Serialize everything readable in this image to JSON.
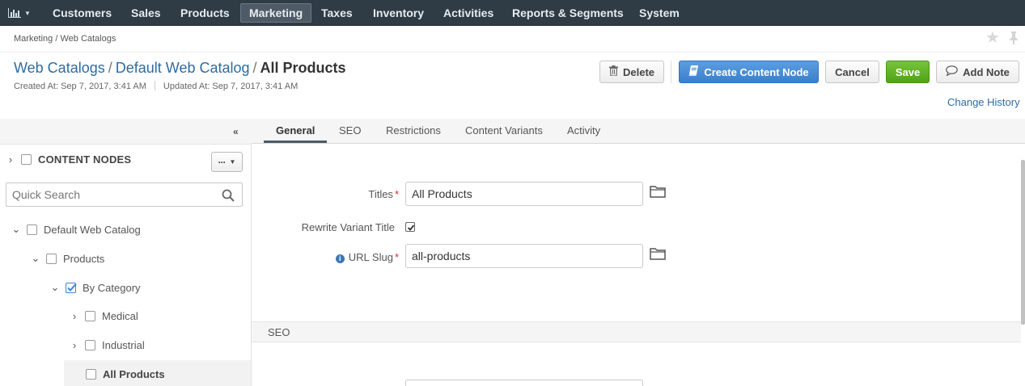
{
  "nav": {
    "logo_icon": "bar-chart-icon",
    "items": [
      "Customers",
      "Sales",
      "Products",
      "Marketing",
      "Taxes",
      "Inventory",
      "Activities",
      "Reports & Segments",
      "System"
    ],
    "active": "Marketing"
  },
  "breadcrumb": "Marketing / Web Catalogs",
  "title": {
    "crumb1": "Web Catalogs",
    "crumb2": "Default Web Catalog",
    "separator": "/",
    "current": "All Products"
  },
  "meta": {
    "created": "Created At: Sep 7, 2017, 3:41 AM",
    "updated": "Updated At: Sep 7, 2017, 3:41 AM"
  },
  "toolbar": {
    "delete_label": "Delete",
    "create_label": "Create Content Node",
    "cancel_label": "Cancel",
    "save_label": "Save",
    "add_note_label": "Add Note",
    "change_history_label": "Change History"
  },
  "sidebar": {
    "nodes_title": "CONTENT NODES",
    "actions_label": "···",
    "search_placeholder": "Quick Search",
    "tree": [
      {
        "label": "Default Web Catalog",
        "expanded": true,
        "checked": false
      },
      {
        "label": "Products",
        "expanded": true,
        "checked": false
      },
      {
        "label": "By Category",
        "expanded": true,
        "checked": true
      },
      {
        "label": "Medical",
        "expanded": false,
        "checked": false
      },
      {
        "label": "Industrial",
        "expanded": false,
        "checked": false
      },
      {
        "label": "All Products",
        "expanded": null,
        "checked": false,
        "selected": true
      }
    ]
  },
  "tabs": [
    "General",
    "SEO",
    "Restrictions",
    "Content Variants",
    "Activity"
  ],
  "active_tab": "General",
  "form": {
    "titles_label": "Titles",
    "titles_value": "All Products",
    "rewrite_label": "Rewrite Variant Title",
    "rewrite_checked": true,
    "url_slug_label": "URL Slug",
    "url_slug_value": "all-products",
    "required_mark": "*"
  },
  "sections": {
    "seo_title": "SEO"
  },
  "colors": {
    "nav_bg": "#2f3b45",
    "link": "#2d6ca2",
    "primary_btn": "#3a7fcc",
    "save_btn": "#4fa318",
    "required": "#d9272e"
  }
}
